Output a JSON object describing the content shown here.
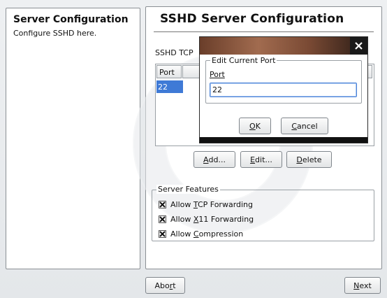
{
  "help": {
    "title": "Server Configuration",
    "text": "Configure SSHD here."
  },
  "main": {
    "title": "SSHD Server Configuration",
    "ports_label": "SSHD TCP",
    "table": {
      "header": "Port",
      "rows": [
        "22"
      ]
    },
    "buttons": {
      "add_pre": "",
      "add_mn": "A",
      "add_post": "dd...",
      "edit_pre": "",
      "edit_mn": "E",
      "edit_post": "dit...",
      "delete_pre": "",
      "delete_mn": "D",
      "delete_post": "elete"
    },
    "features": {
      "legend": "Server Features",
      "items": [
        {
          "pre": "Allow ",
          "mn": "T",
          "post": "CP Forwarding",
          "checked": true
        },
        {
          "pre": "Allow ",
          "mn": "X",
          "post": "11 Forwarding",
          "checked": true
        },
        {
          "pre": "Allow ",
          "mn": "C",
          "post": "ompression",
          "checked": true
        }
      ]
    }
  },
  "dialog": {
    "legend": "Edit Current Port",
    "port_label": "Port",
    "port_value": "22",
    "ok_mn": "O",
    "ok_post": "K",
    "cancel_mn": "C",
    "cancel_post": "ancel"
  },
  "footer": {
    "abort_pre": "Abo",
    "abort_mn": "r",
    "abort_post": "t",
    "next_mn": "N",
    "next_post": "ext"
  }
}
